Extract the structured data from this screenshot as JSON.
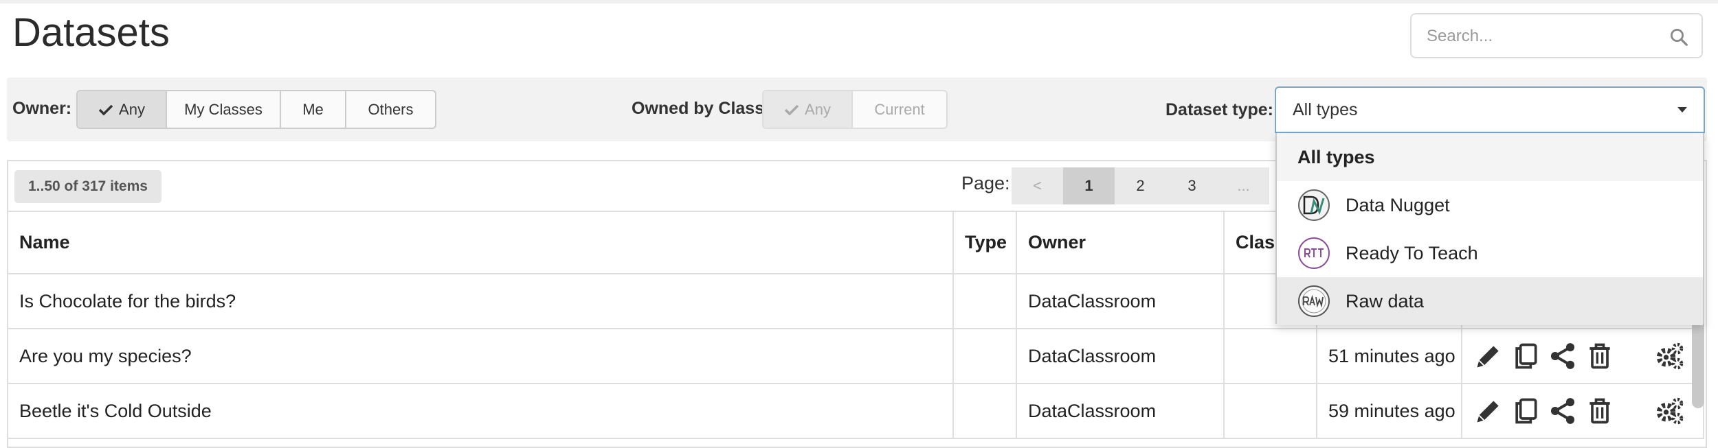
{
  "page": {
    "title": "Datasets"
  },
  "search": {
    "placeholder": "Search..."
  },
  "filters": {
    "owner_label": "Owner:",
    "owner_options": [
      "Any",
      "My Classes",
      "Me",
      "Others"
    ],
    "owner_selected": "Any",
    "class_label": "Owned by Class:",
    "class_options": [
      "Any",
      "Current"
    ],
    "class_selected": "Any",
    "type_label": "Dataset type:",
    "type_selected": "All types"
  },
  "type_dropdown": {
    "options": [
      {
        "label": "All types",
        "icon": null
      },
      {
        "label": "Data Nugget",
        "icon": "data-nugget-logo"
      },
      {
        "label": "Ready To Teach",
        "icon": "rtt-logo"
      },
      {
        "label": "Raw data",
        "icon": "raw-logo"
      }
    ],
    "highlighted": "Raw data"
  },
  "list": {
    "count_label": "1..50 of 317 items",
    "page_label": "Page:",
    "pages": [
      "<",
      "1",
      "2",
      "3",
      "..."
    ],
    "current_page": "1"
  },
  "table": {
    "columns": [
      "Name",
      "Type",
      "Owner",
      "Class",
      "",
      ""
    ],
    "rows": [
      {
        "name": "Is Chocolate for the birds?",
        "type": "",
        "owner": "DataClassroom",
        "class": "",
        "time": ""
      },
      {
        "name": "Are you my species?",
        "type": "",
        "owner": "DataClassroom",
        "class": "",
        "time": "51 minutes ago"
      },
      {
        "name": "Beetle it's Cold Outside",
        "type": "",
        "owner": "DataClassroom",
        "class": "",
        "time": "59 minutes ago"
      }
    ]
  },
  "icons": {
    "edit": "pencil-icon",
    "copy": "copy-icon",
    "share": "share-icon",
    "delete": "trash-icon",
    "settings": "gears-icon",
    "search": "search-icon"
  }
}
